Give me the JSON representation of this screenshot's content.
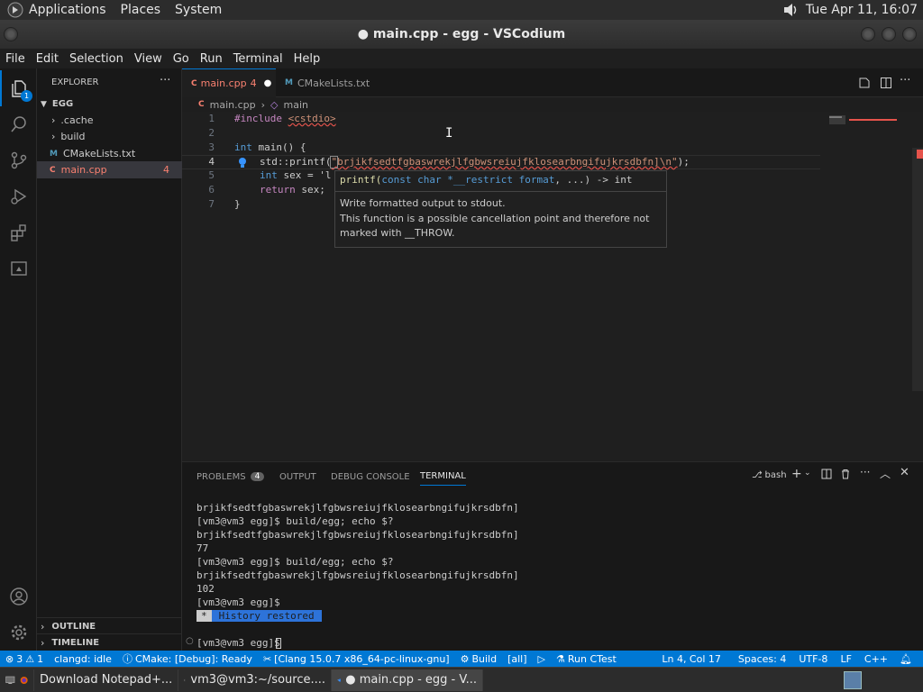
{
  "gnome_panel": {
    "menus": [
      "Applications",
      "Places",
      "System"
    ],
    "clock": "Tue Apr 11, 16:07"
  },
  "window": {
    "title": "● main.cpp - egg - VSCodium"
  },
  "menubar": [
    "File",
    "Edit",
    "Selection",
    "View",
    "Go",
    "Run",
    "Terminal",
    "Help"
  ],
  "activity": {
    "explorer_badge": "1"
  },
  "sidebar": {
    "title": "EXPLORER",
    "folder": "EGG",
    "items": [
      {
        "label": ".cache",
        "type": "folder"
      },
      {
        "label": "build",
        "type": "folder"
      },
      {
        "label": "CMakeLists.txt",
        "type": "file",
        "icon": "M"
      },
      {
        "label": "main.cpp",
        "type": "file",
        "icon": "C",
        "badge": "4"
      }
    ],
    "outline": "OUTLINE",
    "timeline": "TIMELINE"
  },
  "tabs": [
    {
      "label": "main.cpp",
      "count": "4",
      "dirty": "●"
    },
    {
      "label": "CMakeLists.txt"
    }
  ],
  "breadcrumb": {
    "file": "main.cpp",
    "symbol": "main"
  },
  "editor": {
    "line_numbers": [
      "1",
      "2",
      "3",
      "4",
      "5",
      "6",
      "7"
    ],
    "lines": {
      "l1_directive": "#include",
      "l1_header": "<cstdio>",
      "l3_type": "int",
      "l3_rest": " main() {",
      "l4_prefix": "std::printf(",
      "l4_string": "\"brjikfsedtfgbaswrekjlfgbwsreiujfklosearbngifujkrsdbfn]\\n\"",
      "l4_suffix": ");",
      "l5_type": "int",
      "l5_rest": " sex = 'l",
      "l6_kw": "return",
      "l6_rest": " sex;",
      "l7": "}"
    },
    "hover": {
      "signature_fn": "printf(",
      "signature_kw": "const char *__restrict format",
      "signature_tail": ", ...) -> int",
      "line1": "Write formatted output to stdout.",
      "line2": "This function is a possible cancellation point and therefore not",
      "line3": "marked with __THROW."
    }
  },
  "panel": {
    "tabs": [
      {
        "label": "PROBLEMS",
        "badge": "4"
      },
      {
        "label": "OUTPUT"
      },
      {
        "label": "DEBUG CONSOLE"
      },
      {
        "label": "TERMINAL",
        "active": true
      }
    ],
    "shell": "bash",
    "terminal_lines": [
      "brjikfsedtfgbaswrekjlfgbwsreiujfklosearbngifujkrsdbfn]",
      "[vm3@vm3 egg]$ build/egg; echo $?",
      "brjikfsedtfgbaswrekjlfgbwsreiujfklosearbngifujkrsdbfn]",
      "77",
      "[vm3@vm3 egg]$ build/egg; echo $?",
      "brjikfsedtfgbaswrekjlfgbwsreiujfklosearbngifujkrsdbfn]",
      "102",
      "[vm3@vm3 egg]$"
    ],
    "history_star": "*",
    "history_label": "History restored",
    "prompt_symbol": "○",
    "prompt": "[vm3@vm3 egg]$"
  },
  "statusbar": {
    "errors": "3",
    "warnings": "1",
    "clangd": "clangd: idle",
    "cmake": "CMake: [Debug]: Ready",
    "kit": "[Clang 15.0.7 x86_64-pc-linux-gnu]",
    "build": "Build",
    "target": "[all]",
    "ctest": "Run CTest",
    "position": "Ln 4, Col 17",
    "spaces": "Spaces: 4",
    "encoding": "UTF-8",
    "eol": "LF",
    "language": "C++"
  },
  "taskbar": {
    "tasks": [
      "Download Notepad+...",
      "vm3@vm3:~/source....",
      "● main.cpp - egg - V..."
    ]
  }
}
